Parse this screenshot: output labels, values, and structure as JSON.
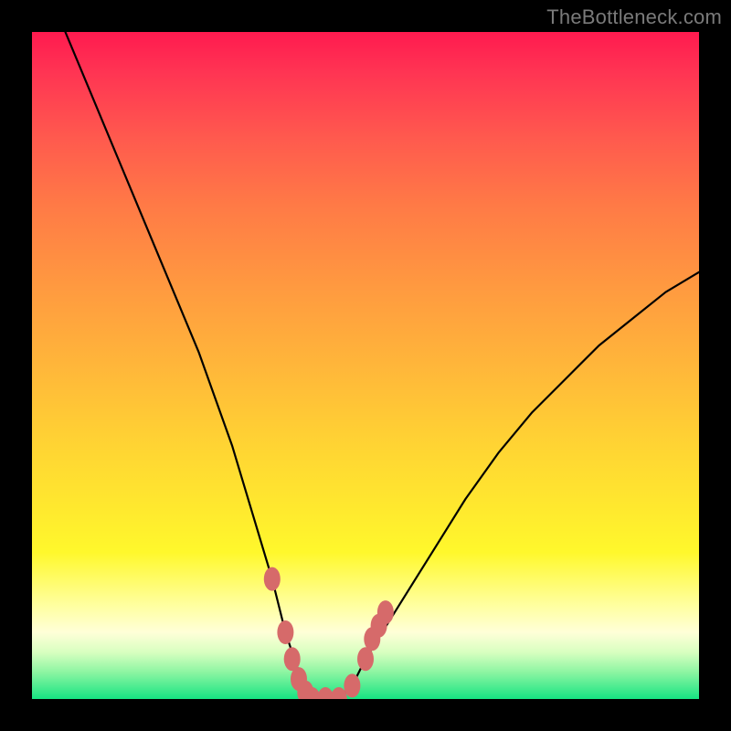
{
  "watermark": "TheBottleneck.com",
  "colors": {
    "black": "#000000",
    "watermark_text": "#7a7a7a",
    "curve_primary": "#000000",
    "curve_accent": "#d66a6a",
    "gradient": [
      "#ff1a4f",
      "#ff7a46",
      "#ffd433",
      "#ffffd8",
      "#34e88a"
    ]
  },
  "chart_data": {
    "type": "line",
    "title": "",
    "xlabel": "",
    "ylabel": "",
    "xlim": [
      0,
      100
    ],
    "ylim": [
      0,
      100
    ],
    "grid": false,
    "legend": false,
    "series": [
      {
        "name": "bottleneck-curve",
        "color": "#000000",
        "x": [
          5,
          10,
          15,
          20,
          25,
          30,
          33,
          36,
          38,
          40,
          42,
          44,
          46,
          48,
          50,
          55,
          60,
          65,
          70,
          75,
          80,
          85,
          90,
          95,
          100
        ],
        "values": [
          100,
          88,
          76,
          64,
          52,
          38,
          28,
          18,
          10,
          4,
          1,
          0,
          0,
          2,
          6,
          14,
          22,
          30,
          37,
          43,
          48,
          53,
          57,
          61,
          64
        ]
      }
    ],
    "annotations": [
      {
        "name": "accent-dots-left",
        "color": "#d66a6a",
        "points": [
          {
            "x": 36,
            "y": 18
          },
          {
            "x": 38,
            "y": 10
          },
          {
            "x": 39,
            "y": 6
          },
          {
            "x": 40,
            "y": 3
          },
          {
            "x": 41,
            "y": 1
          },
          {
            "x": 42,
            "y": 0
          },
          {
            "x": 44,
            "y": 0
          },
          {
            "x": 46,
            "y": 0
          }
        ]
      },
      {
        "name": "accent-dots-right",
        "color": "#d66a6a",
        "points": [
          {
            "x": 48,
            "y": 2
          },
          {
            "x": 50,
            "y": 6
          },
          {
            "x": 51,
            "y": 9
          },
          {
            "x": 52,
            "y": 11
          },
          {
            "x": 53,
            "y": 13
          }
        ]
      }
    ]
  }
}
